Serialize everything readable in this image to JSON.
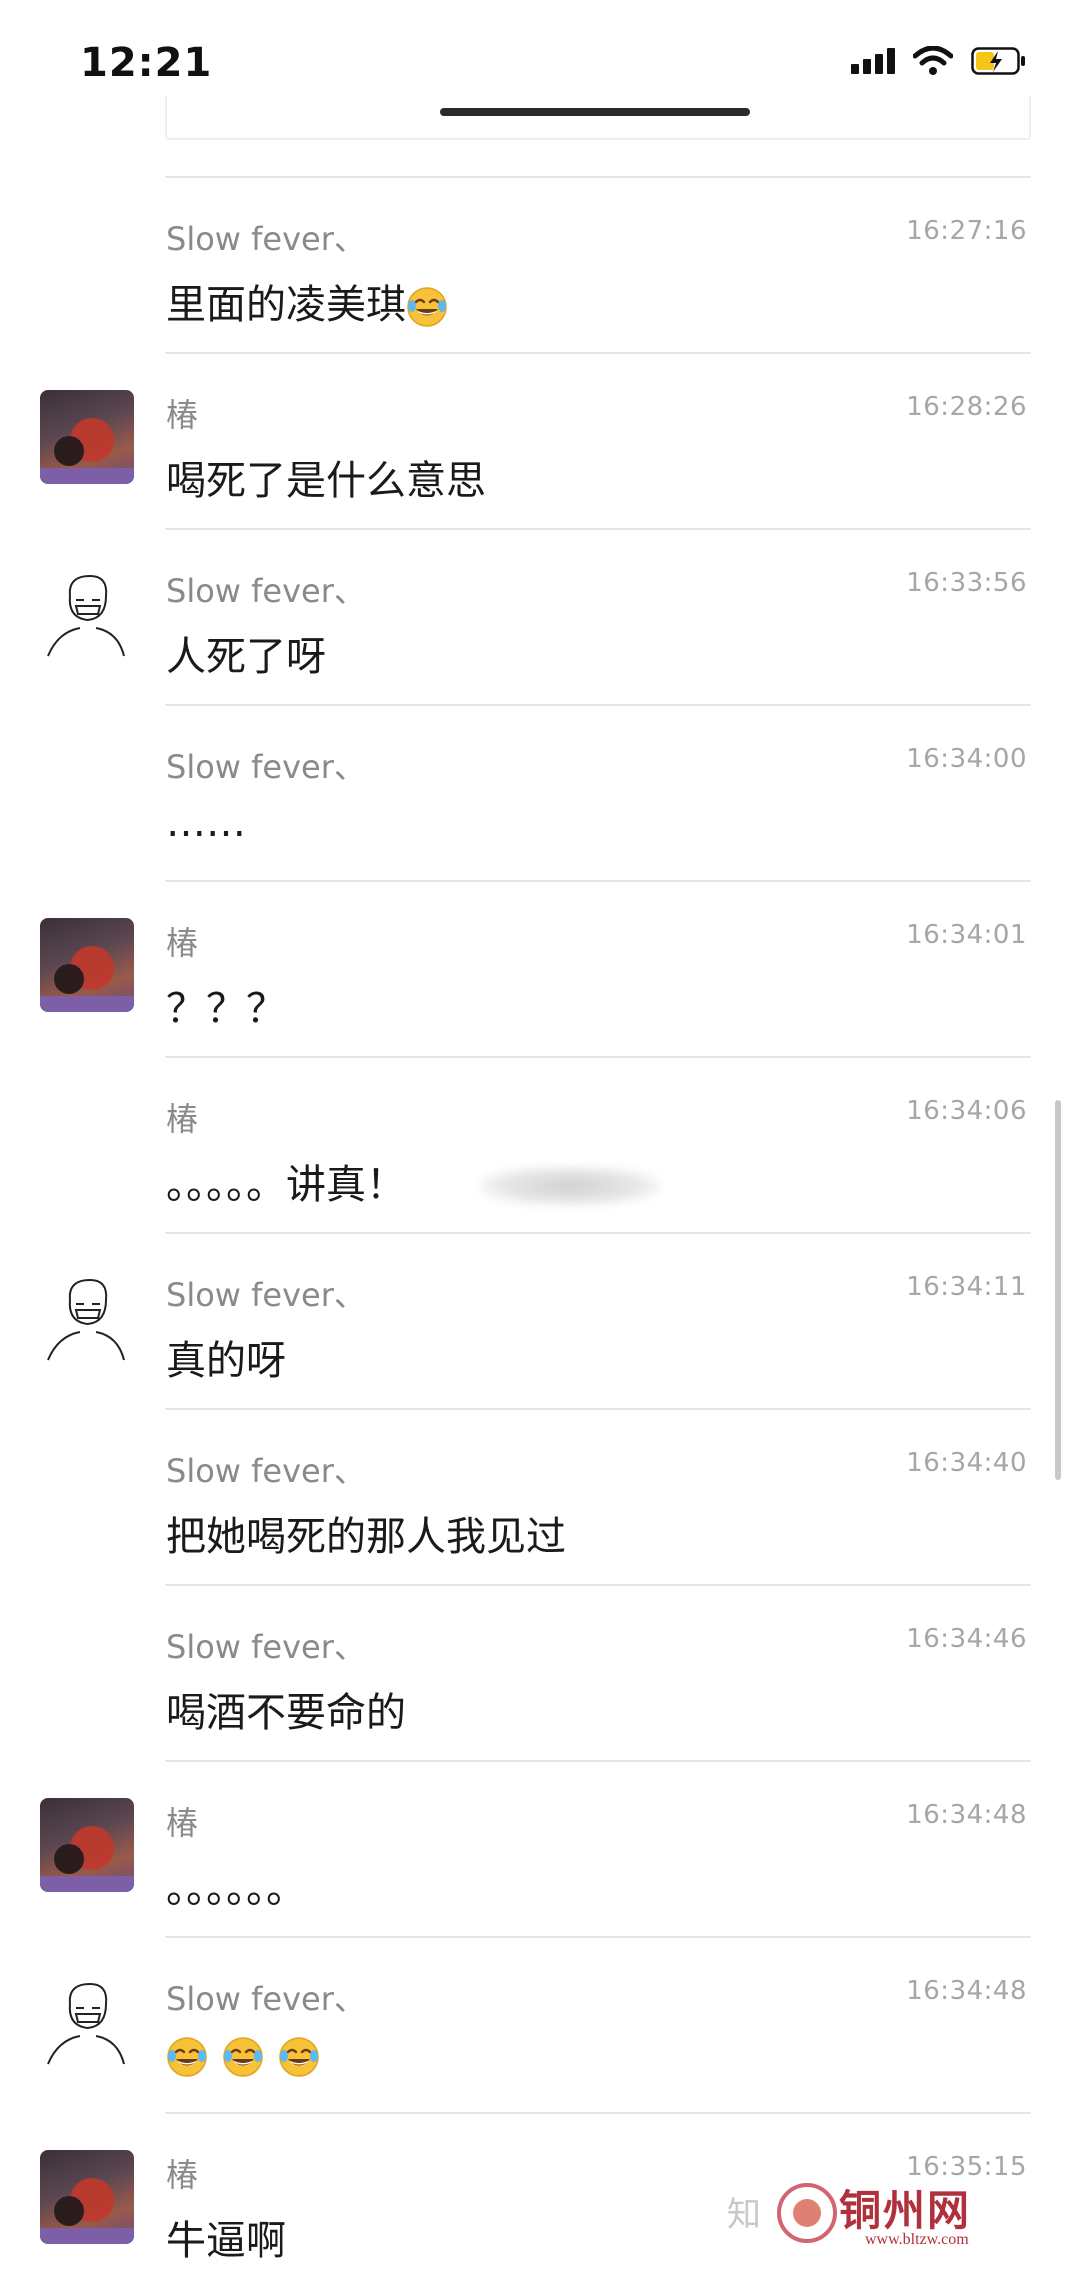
{
  "status_bar": {
    "time": "12:21"
  },
  "messages": [
    {
      "sender": "Slow fever、",
      "time": "16:27:16",
      "text": "里面的凌美琪",
      "avatar": "none",
      "emoji_count": 1
    },
    {
      "sender": "椿",
      "time": "16:28:26",
      "text": "喝死了是什么意思",
      "avatar": "photo"
    },
    {
      "sender": "Slow fever、",
      "time": "16:33:56",
      "text": "人死了呀",
      "avatar": "sketch"
    },
    {
      "sender": "Slow fever、",
      "time": "16:34:00",
      "text": "……",
      "avatar": "none"
    },
    {
      "sender": "椿",
      "time": "16:34:01",
      "text": "？？？",
      "avatar": "photo"
    },
    {
      "sender": "椿",
      "time": "16:34:06",
      "text": "。。。。。讲真！",
      "avatar": "none",
      "blurred": true
    },
    {
      "sender": "Slow fever、",
      "time": "16:34:11",
      "text": "真的呀",
      "avatar": "sketch"
    },
    {
      "sender": "Slow fever、",
      "time": "16:34:40",
      "text": "把她喝死的那人我见过",
      "avatar": "none"
    },
    {
      "sender": "Slow fever、",
      "time": "16:34:46",
      "text": "喝酒不要命的",
      "avatar": "none"
    },
    {
      "sender": "椿",
      "time": "16:34:48",
      "text": "。。。。。。",
      "avatar": "photo"
    },
    {
      "sender": "Slow fever、",
      "time": "16:34:48",
      "text": "",
      "avatar": "sketch",
      "emoji_count": 3
    },
    {
      "sender": "椿",
      "time": "16:35:15",
      "text": "牛逼啊",
      "avatar": "photo"
    }
  ],
  "watermark": {
    "zhihu": "知",
    "brand": "铜州网",
    "url": "www.bltzw.com"
  },
  "icons": {
    "signal": "signal-icon",
    "wifi": "wifi-icon",
    "battery": "battery-charging-icon",
    "emoji": "tears-of-joy-emoji"
  },
  "colors": {
    "sender_name": "#8a8a8a",
    "timestamp": "#a6a6a6",
    "message_text": "#1a1a1a",
    "divider": "#e6e6e6",
    "battery_charge": "#f5c518",
    "watermark_brand": "#b0303c"
  }
}
